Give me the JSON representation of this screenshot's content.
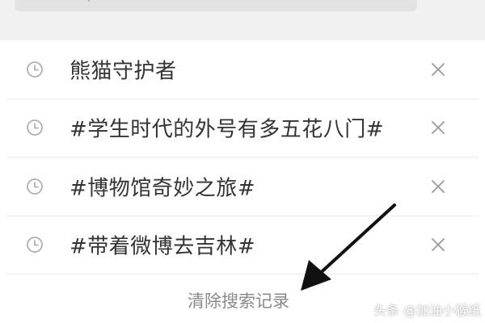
{
  "search": {
    "cursor_color": "#6fd0b7"
  },
  "history": {
    "items": [
      {
        "label": "熊猫守护者",
        "icon": "clock-icon",
        "action_icon": "close-icon"
      },
      {
        "label": "#学生时代的外号有多五花八门#",
        "icon": "clock-icon",
        "action_icon": "close-icon"
      },
      {
        "label": "#博物馆奇妙之旅#",
        "icon": "clock-icon",
        "action_icon": "close-icon"
      },
      {
        "label": "#带着微博去吉林#",
        "icon": "clock-icon",
        "action_icon": "close-icon"
      }
    ],
    "clear_label": "清除搜索记录"
  },
  "overlay": {
    "arrow_color": "#111111",
    "watermark": "头条 @加油小猴纸"
  }
}
